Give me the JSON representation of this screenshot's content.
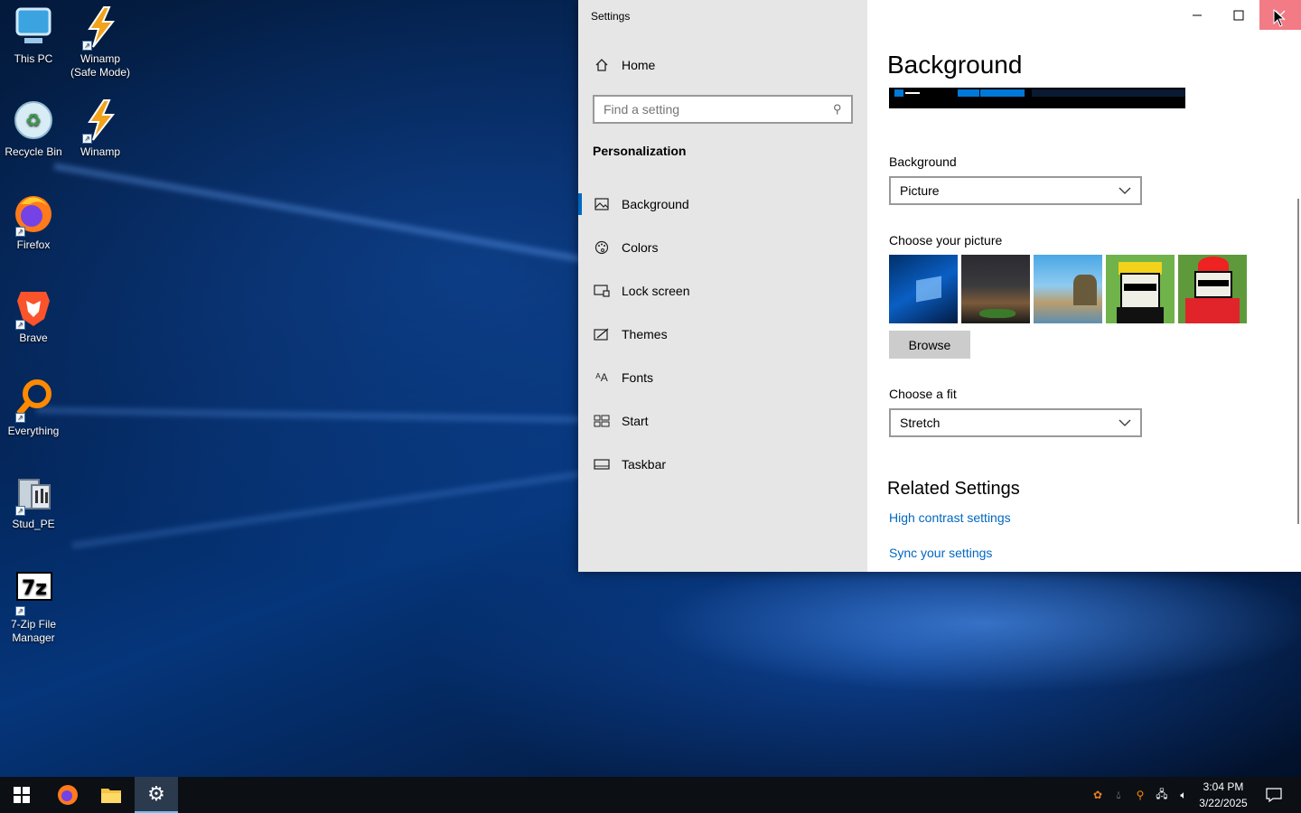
{
  "desktop": {
    "icons": [
      {
        "label": "This PC"
      },
      {
        "label": "Winamp\n(Safe Mode)"
      },
      {
        "label": "Recycle Bin"
      },
      {
        "label": "Winamp"
      },
      {
        "label": "Firefox"
      },
      {
        "label": "Brave"
      },
      {
        "label": "Everything"
      },
      {
        "label": "Stud_PE"
      },
      {
        "label": "7-Zip File\nManager"
      }
    ]
  },
  "settings": {
    "window_title": "Settings",
    "home_label": "Home",
    "search_placeholder": "Find a setting",
    "section_title": "Personalization",
    "nav": [
      {
        "label": "Background",
        "icon": "picture-icon",
        "active": true
      },
      {
        "label": "Colors",
        "icon": "palette-icon"
      },
      {
        "label": "Lock screen",
        "icon": "lock-screen-icon"
      },
      {
        "label": "Themes",
        "icon": "themes-icon"
      },
      {
        "label": "Fonts",
        "icon": "fonts-icon"
      },
      {
        "label": "Start",
        "icon": "start-icon"
      },
      {
        "label": "Taskbar",
        "icon": "taskbar-icon"
      }
    ],
    "page_title": "Background",
    "background_label": "Background",
    "background_value": "Picture",
    "choose_picture_label": "Choose your picture",
    "browse_label": "Browse",
    "choose_fit_label": "Choose a fit",
    "fit_value": "Stretch",
    "related_title": "Related Settings",
    "links": [
      "High contrast settings",
      "Sync your settings"
    ]
  },
  "taskbar": {
    "time": "3:04 PM",
    "date": "3/22/2025",
    "accent": "#76b9ed"
  }
}
